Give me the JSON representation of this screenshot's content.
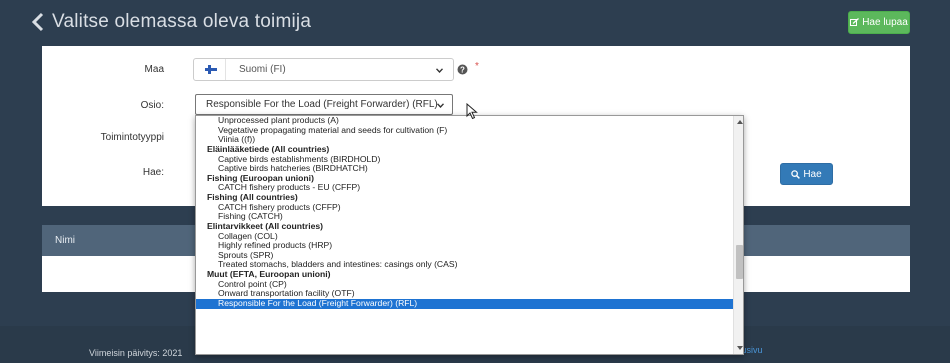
{
  "header": {
    "title": "Valitse olemassa oleva toimija",
    "apply_button": "Hae lupaa"
  },
  "form": {
    "maa_label": "Maa",
    "maa_value": "Suomi (FI)",
    "required_mark": "*",
    "osio_label": "Osio:",
    "osio_value": "Responsible For the Load (Freight Forwarder) (RFL)",
    "toimintotyyppi_label": "Toimintotyyppi",
    "hae_label": "Hae:",
    "search_button": "Hae"
  },
  "results": {
    "name_column": "Nimi"
  },
  "footer": {
    "last_updated": "Viimeisin päivitys: 2021",
    "links": [
      "dot",
      "Etusivu"
    ]
  },
  "dropdown_items": [
    {
      "label": "Unprocessed plant products (A)",
      "group": false
    },
    {
      "label": "Vegetative propagating material and seeds for cultivation (F)",
      "group": false
    },
    {
      "label": "Viinia ((f))",
      "group": false
    },
    {
      "label": "Eläinlääketiede (All countries)",
      "group": true
    },
    {
      "label": "Captive birds establishments (BIRDHOLD)",
      "group": false
    },
    {
      "label": "Captive birds hatcheries (BIRDHATCH)",
      "group": false
    },
    {
      "label": "Fishing (Euroopan unioni)",
      "group": true
    },
    {
      "label": "CATCH fishery products - EU (CFFP)",
      "group": false
    },
    {
      "label": "Fishing (All countries)",
      "group": true
    },
    {
      "label": "CATCH fishery products (CFFP)",
      "group": false
    },
    {
      "label": "Fishing (CATCH)",
      "group": false
    },
    {
      "label": "Elintarvikkeet (All countries)",
      "group": true
    },
    {
      "label": "Collagen (COL)",
      "group": false
    },
    {
      "label": "Highly refined products (HRP)",
      "group": false
    },
    {
      "label": "Sprouts (SPR)",
      "group": false
    },
    {
      "label": "Treated stomachs, bladders and intestines: casings only (CAS)",
      "group": false
    },
    {
      "label": "Muut (EFTA, Euroopan unioni)",
      "group": true
    },
    {
      "label": "Control point (CP)",
      "group": false
    },
    {
      "label": "Onward transportation facility (OTF)",
      "group": false
    },
    {
      "label": "Responsible For the Load (Freight Forwarder) (RFL)",
      "group": false,
      "selected": true
    }
  ],
  "colors": {
    "background": "#2d3e50",
    "accent_green": "#5cb85c",
    "accent_blue": "#337ab7",
    "selection": "#1e73d2",
    "required": "#d9534f"
  },
  "icons": [
    "chevron-left-icon",
    "edit-icon",
    "finland-flag-icon",
    "chevron-down-icon",
    "info-icon",
    "search-icon",
    "mouse-cursor-icon"
  ]
}
